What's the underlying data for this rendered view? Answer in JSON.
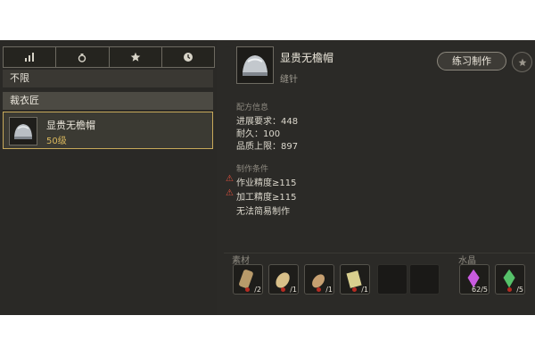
{
  "left": {
    "filter_tabs": [
      {
        "icon": "bar-chart-icon"
      },
      {
        "icon": "money-bag-icon"
      },
      {
        "icon": "star-icon"
      },
      {
        "icon": "clock-icon"
      }
    ],
    "unlimited_label": "不限",
    "category_label": "裁衣匠",
    "recipe": {
      "name": "显贵无檐帽",
      "level": "50级"
    }
  },
  "detail": {
    "title": "显贵无檐帽",
    "subtitle": "缝针",
    "practice_button": "练习制作",
    "recipe_info": {
      "header": "配方信息",
      "lines": [
        "进展要求：448",
        "耐久：100",
        "品质上限：897"
      ]
    },
    "craft_conditions": {
      "header": "制作条件",
      "lines": [
        "作业精度≥115",
        "加工精度≥115",
        "无法简易制作"
      ]
    },
    "materials": {
      "header": "素材",
      "slots": [
        {
          "count": "/2",
          "color": "#b89a6a"
        },
        {
          "count": "/1",
          "color": "#d9c089"
        },
        {
          "count": "/1",
          "color": "#c7a071"
        },
        {
          "count": "/1",
          "color": "#d9cf8e"
        }
      ]
    },
    "crystals": {
      "header": "水晶",
      "slots": [
        {
          "count": "62/5",
          "color": "#c95be0"
        },
        {
          "count": "/5",
          "color": "#56c26a"
        }
      ]
    }
  },
  "colors": {
    "accent_gold": "#c7a95a",
    "warning": "#e2523f"
  }
}
